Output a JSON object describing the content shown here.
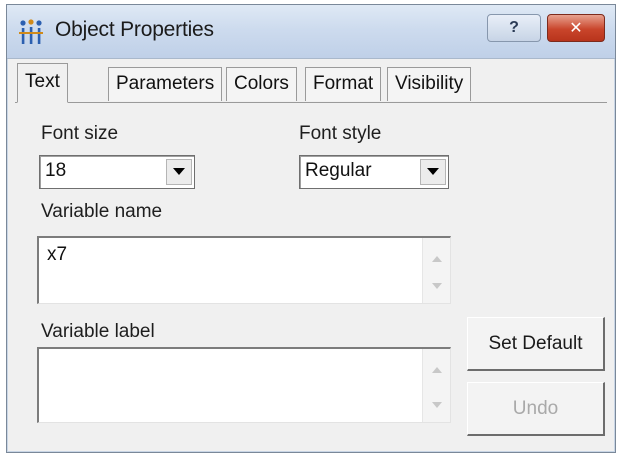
{
  "window": {
    "title": "Object Properties",
    "help_label": "?",
    "close_label": "✕"
  },
  "tabs": [
    {
      "label": "Text",
      "active": true
    },
    {
      "label": "Parameters",
      "active": false
    },
    {
      "label": "Colors",
      "active": false
    },
    {
      "label": "Format",
      "active": false
    },
    {
      "label": "Visibility",
      "active": false
    }
  ],
  "font_size": {
    "label": "Font size",
    "value": "18"
  },
  "font_style": {
    "label": "Font style",
    "value": "Regular"
  },
  "variable_name": {
    "label": "Variable name",
    "value": "x7"
  },
  "variable_label": {
    "label": "Variable label",
    "value": ""
  },
  "buttons": {
    "set_default": "Set Default",
    "undo": "Undo"
  },
  "icons": {
    "app": "network-tree-icon",
    "dropdown": "chevron-down-icon",
    "scroll_up": "scroll-up-arrow-icon",
    "scroll_down": "scroll-down-arrow-icon"
  },
  "colors": {
    "titlebar": "#cddbee",
    "close_button": "#c9452b",
    "dialog_background": "#f0f0f0"
  }
}
